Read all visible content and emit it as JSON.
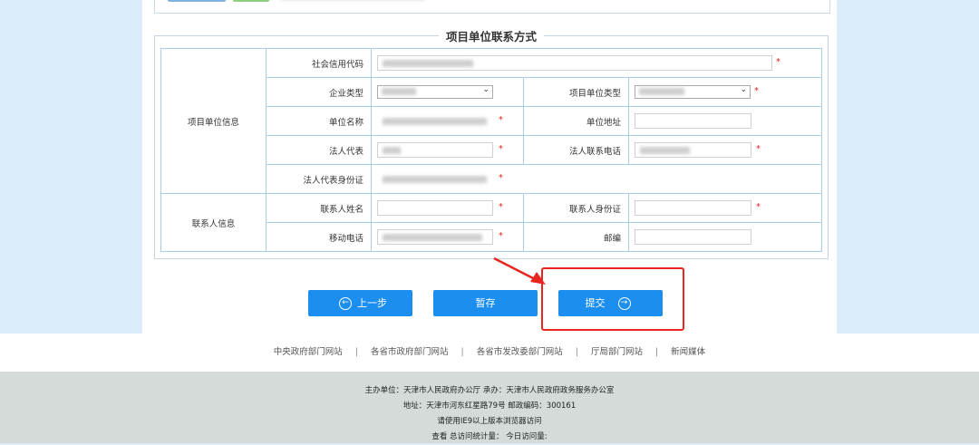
{
  "section": {
    "legend": "项目单位联系方式"
  },
  "groups": {
    "project_unit_info": "项目单位信息",
    "contact_info": "联系人信息"
  },
  "fields": {
    "credit_code": "社会信用代码",
    "enterprise_type": "企业类型",
    "project_unit_type": "项目单位类型",
    "unit_name": "单位名称",
    "unit_address": "单位地址",
    "legal_rep": "法人代表",
    "legal_phone": "法人联系电话",
    "legal_id": "法人代表身份证",
    "contact_name": "联系人姓名",
    "contact_id": "联系人身份证",
    "mobile": "移动电话",
    "postcode": "邮编"
  },
  "required_mark": "*",
  "buttons": {
    "prev": "上一步",
    "save_draft": "暂存",
    "submit": "提交"
  },
  "icons": {
    "prev": "arrow-left-circle-icon",
    "submit": "arrow-right-circle-icon"
  },
  "colors": {
    "primary": "#1b8ef0",
    "highlight": "#e8261f",
    "footer_bg": "#d4dbd9",
    "page_bg": "#dcecf9"
  },
  "footer_links": [
    "中央政府部门网站",
    "各省市政府部门网站",
    "各省市发改委部门网站",
    "厅局部门网站",
    "新闻媒体"
  ],
  "footer_sep": "|",
  "footer": {
    "line1": "主办单位：天津市人民政府办公厅 承办：天津市人民政府政务服务办公室",
    "line2": "地址：天津市河东红星路79号 邮政编码：300161",
    "line3": "请使用IE9以上版本浏览器访问",
    "line4": "查看 总访问统计量： 今日访问量:"
  }
}
